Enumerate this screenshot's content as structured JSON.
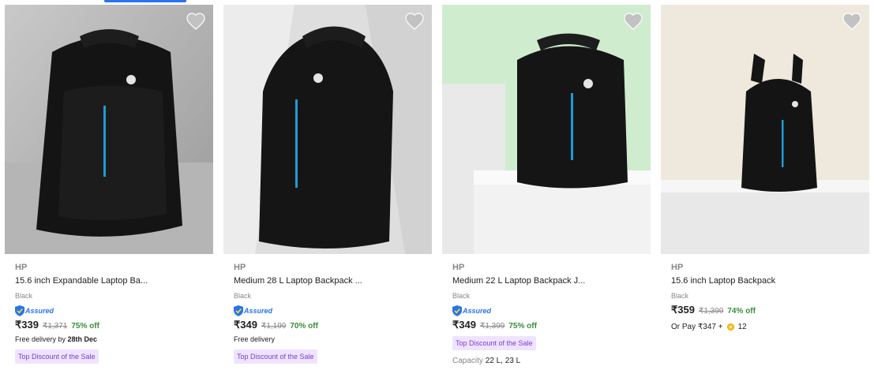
{
  "accent_color": "#2874f0",
  "products": [
    {
      "brand": "HP",
      "title": "15.6 inch Expandable Laptop Ba...",
      "color": "Black",
      "assured": "Assured",
      "price": "₹339",
      "mrp": "₹1,371",
      "discount": "75% off",
      "delivery_prefix": "Free delivery by ",
      "delivery_date": "28th Dec",
      "tag": "Top Discount of the Sale",
      "wishlist_icon": "heart-icon"
    },
    {
      "brand": "HP",
      "title": "Medium 28 L Laptop Backpack ...",
      "color": "Black",
      "assured": "Assured",
      "price": "₹349",
      "mrp": "₹1,199",
      "discount": "70% off",
      "delivery_prefix": "Free delivery",
      "delivery_date": "",
      "tag": "Top Discount of the Sale",
      "wishlist_icon": "heart-icon"
    },
    {
      "brand": "HP",
      "title": "Medium 22 L Laptop Backpack J...",
      "color": "Black",
      "assured": "Assured",
      "price": "₹349",
      "mrp": "₹1,399",
      "discount": "75% off",
      "tag": "Top Discount of the Sale",
      "capacity_label": "Capacity",
      "capacity_value": "22 L, 23 L",
      "wishlist_icon": "heart-icon"
    },
    {
      "brand": "HP",
      "title": "15.6 inch Laptop Backpack",
      "color": "Black",
      "price": "₹359",
      "mrp": "₹1,399",
      "discount": "74% off",
      "or_pay": "Or Pay ₹347 +",
      "coins": "12",
      "wishlist_icon": "heart-icon"
    }
  ]
}
